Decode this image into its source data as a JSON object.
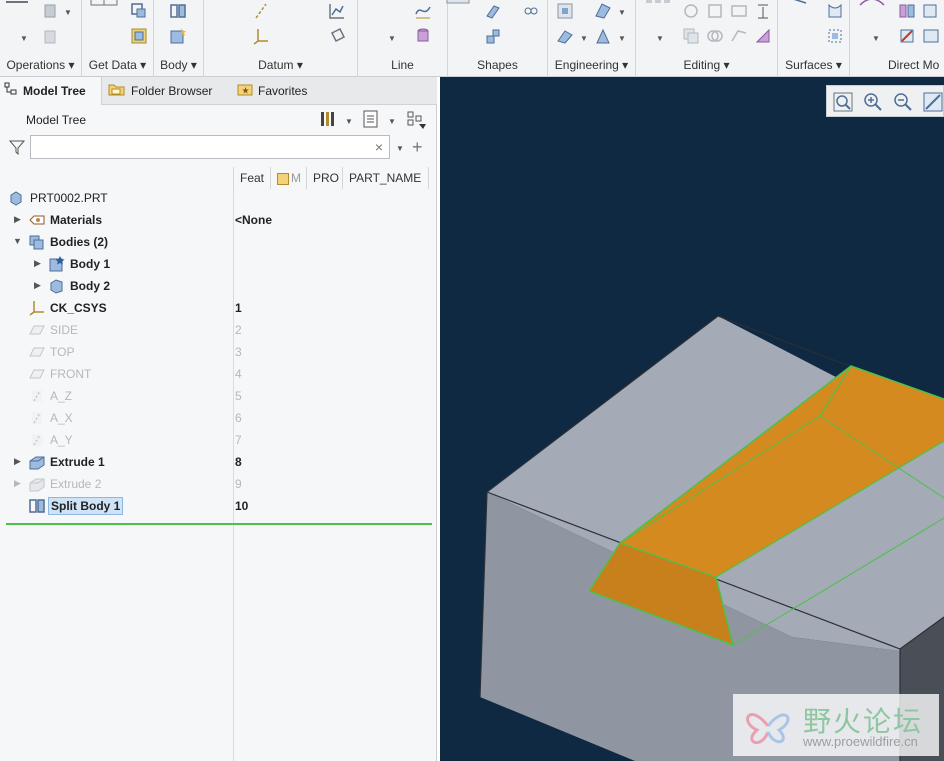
{
  "ribbon": {
    "groups": [
      {
        "label": "Operations"
      },
      {
        "label": "Get Data"
      },
      {
        "label": "Body"
      },
      {
        "label": "Datum"
      },
      {
        "label": "Line"
      },
      {
        "label": "Shapes"
      },
      {
        "label": "Engineering"
      },
      {
        "label": "Editing"
      },
      {
        "label": "Surfaces"
      },
      {
        "label": "Direct Mo"
      }
    ]
  },
  "panel": {
    "tabs": [
      {
        "label": "Model Tree",
        "icon": "model-tree-icon"
      },
      {
        "label": "Folder Browser",
        "icon": "folder-icon"
      },
      {
        "label": "Favorites",
        "icon": "favorites-icon"
      }
    ],
    "title": "Model Tree",
    "search": {
      "value": "",
      "placeholder": ""
    },
    "columns": [
      "Feat",
      "M",
      "PRO",
      "PART_NAME"
    ]
  },
  "tree": {
    "root": "PRT0002.PRT",
    "items": [
      {
        "name": "Materials",
        "num": "<None"
      },
      {
        "name": "Bodies (2)",
        "num": ""
      },
      {
        "name": "Body 1",
        "num": ""
      },
      {
        "name": "Body 2",
        "num": ""
      },
      {
        "name": "CK_CSYS",
        "num": "1"
      },
      {
        "name": "SIDE",
        "num": "2"
      },
      {
        "name": "TOP",
        "num": "3"
      },
      {
        "name": "FRONT",
        "num": "4"
      },
      {
        "name": "A_Z",
        "num": "5"
      },
      {
        "name": "A_X",
        "num": "6"
      },
      {
        "name": "A_Y",
        "num": "7"
      },
      {
        "name": "Extrude 1",
        "num": "8"
      },
      {
        "name": "Extrude 2",
        "num": "9"
      },
      {
        "name": "Split Body 1",
        "num": "10"
      }
    ]
  },
  "watermark": {
    "title": "野火论坛",
    "url": "www.proewildfire.cn"
  },
  "colors": {
    "viewport_bg": "#0f2942",
    "body_gray": "#a4abb6",
    "highlight": "#d58a1f",
    "edge": "#4cc14a",
    "selection": "#cfe3f7"
  }
}
